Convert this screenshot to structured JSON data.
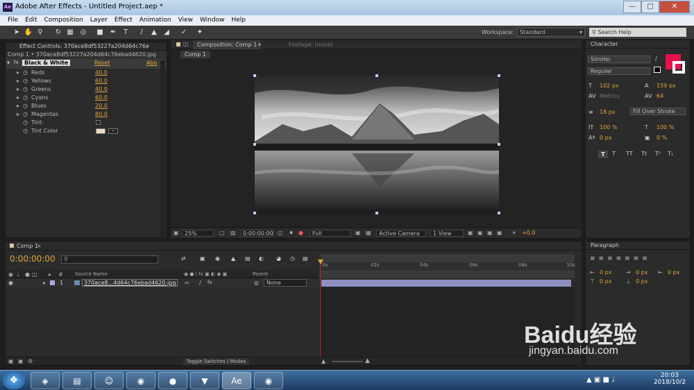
{
  "window": {
    "title": "Adobe After Effects - Untitled Project.aep *",
    "app_icon": "Ae"
  },
  "menu": [
    "File",
    "Edit",
    "Composition",
    "Layer",
    "Effect",
    "Animation",
    "View",
    "Window",
    "Help"
  ],
  "toolbar": {
    "workspace_label": "Workspace:",
    "workspace_value": "Standard",
    "search_help": "Search Help"
  },
  "effect_controls": {
    "tab_label": "Effect Controls: 370ace8df53227a204d64c76e",
    "layer_path": "Comp 1 • 370ace8df53227a204d64c76ebad4620.jpg",
    "effect_name": "Black & White",
    "reset": "Reset",
    "about": "Abo",
    "params": [
      {
        "name": "Reds",
        "value": "40.0"
      },
      {
        "name": "Yellows",
        "value": "60.0"
      },
      {
        "name": "Greens",
        "value": "40.0"
      },
      {
        "name": "Cyans",
        "value": "60.0"
      },
      {
        "name": "Blues",
        "value": "20.0"
      },
      {
        "name": "Magentas",
        "value": "80.0"
      }
    ],
    "tint_label": "Tint:",
    "tint_color_label": "Tint Color"
  },
  "composition": {
    "tab_label": "Composition: Comp 1",
    "footage_tab": "Footage: (none)",
    "sub_tab": "Comp 1",
    "zoom": "25%",
    "timecode": "0:00:00:00",
    "quality": "Full",
    "camera": "Active Camera",
    "views": "1 View",
    "exposure": "+0.0"
  },
  "character": {
    "tab_label": "Character",
    "font": "SimHei",
    "style": "Regular",
    "font_size": "102 px",
    "leading": "159 px",
    "kerning": "Metrics",
    "tracking": "64",
    "stroke_width": "18 px",
    "stroke_mode": "Fill Over Stroke",
    "vscale": "100 %",
    "hscale": "100 %",
    "baseline": "0 px",
    "tsume": "0 %",
    "styles": [
      "T",
      "T",
      "TT",
      "Tt",
      "T¹",
      "T₁"
    ],
    "fill_color": "#e8124a"
  },
  "paragraph": {
    "tab_label": "Paragraph",
    "indents": [
      "0 px",
      "0 px",
      "0 px",
      "0 px",
      "0 px"
    ]
  },
  "timeline": {
    "tab_label": "Comp 1",
    "timecode": "0:00:00:00",
    "col_source": "Source Name",
    "col_parent": "Parent",
    "layer_num": "1",
    "layer_name": "370ace8...4d64c76ebad4620.jpg",
    "parent_value": "None",
    "ruler": [
      "0s",
      "02s",
      "04s",
      "06s",
      "08s",
      "10s"
    ],
    "toggle_label": "Toggle Switches / Modes"
  },
  "taskbar": {
    "time": "20:03",
    "date": "2018/10/2"
  },
  "watermark": {
    "brand": "Baidu经验",
    "url": "jingyan.baidu.com"
  }
}
